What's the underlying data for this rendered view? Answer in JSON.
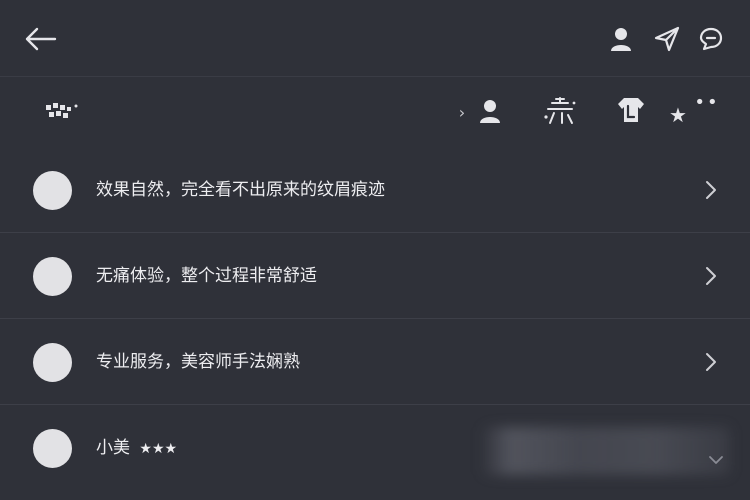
{
  "header": {
    "back_icon": "arrow-left-icon",
    "icons": [
      "person-icon",
      "send-icon",
      "chat-bubble-icon"
    ]
  },
  "toolbar": {
    "left_icon": "emoji-grid-icon",
    "small_chevron": "›",
    "star": "★",
    "dots": "••"
  },
  "comments": [
    {
      "text": "效果自然，完全看不出原来的纹眉痕迹"
    },
    {
      "text": "无痛体验，整个过程非常舒适"
    },
    {
      "text": "专业服务，美容师手法娴熟"
    }
  ],
  "user_row": {
    "name": "小美",
    "stars": "★★★"
  },
  "colors": {
    "background": "#2f3139",
    "divider": "#3d3f48",
    "text": "#ededf0",
    "icon": "#e6e6ea",
    "avatar": "#e2e2e5"
  }
}
